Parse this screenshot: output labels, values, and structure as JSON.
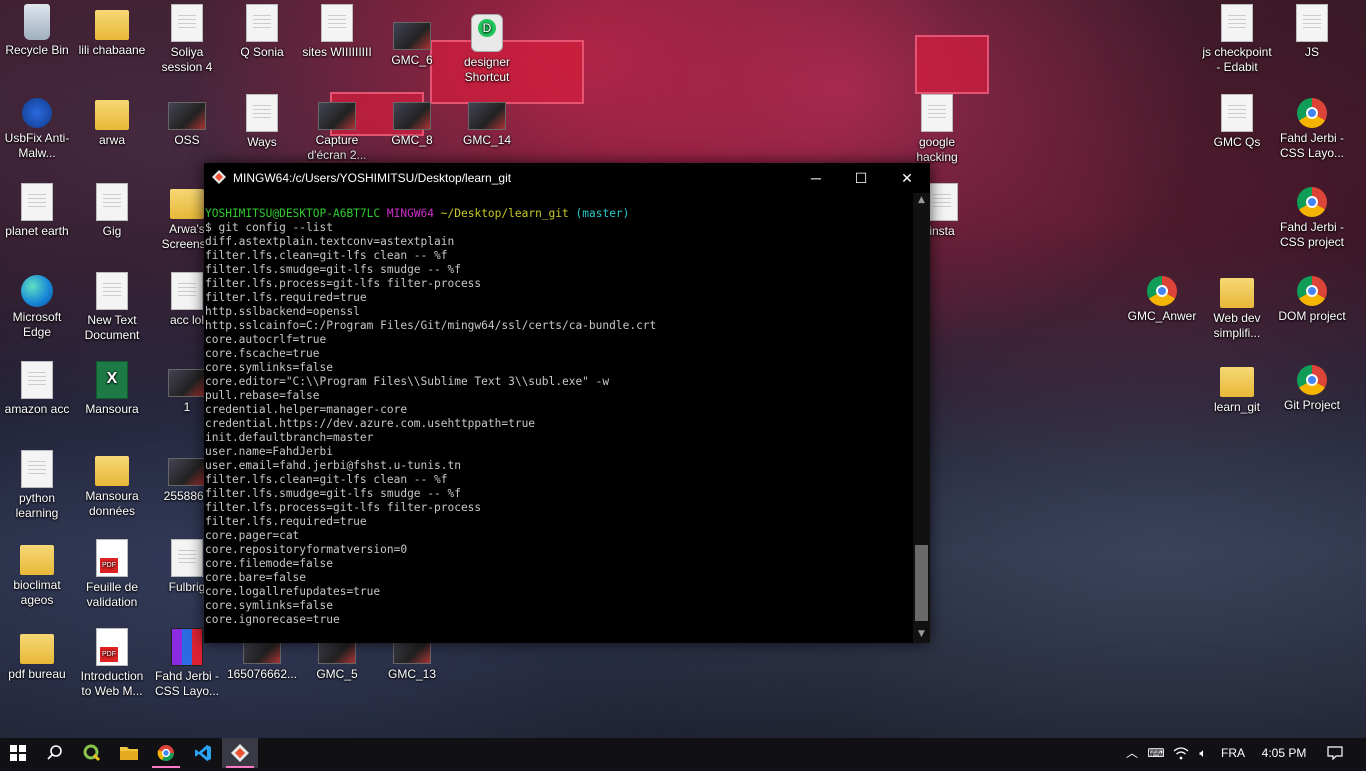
{
  "desktop": {
    "icons": [
      {
        "label": "Recycle Bin",
        "type": "recycle"
      },
      {
        "label": "lili chabaane",
        "type": "folder"
      },
      {
        "label": "Soliya session 4",
        "type": "doc"
      },
      {
        "label": "Q Sonia",
        "type": "doc"
      },
      {
        "label": "sites WIIIIIIIII",
        "type": "doc"
      },
      {
        "label": "GMC_6",
        "type": "img"
      },
      {
        "label": "designer Shortcut",
        "type": "gitbash"
      },
      {
        "label": "js checkpoint - Edabit",
        "type": "doc"
      },
      {
        "label": "JS",
        "type": "doc"
      },
      {
        "label": "UsbFix Anti-Malw...",
        "type": "usb"
      },
      {
        "label": "arwa",
        "type": "folder"
      },
      {
        "label": "OSS",
        "type": "img"
      },
      {
        "label": "Ways",
        "type": "doc"
      },
      {
        "label": "Capture d'écran 2...",
        "type": "img"
      },
      {
        "label": "GMC_8",
        "type": "img"
      },
      {
        "label": "GMC_14",
        "type": "img"
      },
      {
        "label": "google hacking",
        "type": "doc"
      },
      {
        "label": "GMC Qs",
        "type": "doc"
      },
      {
        "label": "Fahd Jerbi - CSS Layo...",
        "type": "chrome"
      },
      {
        "label": "planet earth",
        "type": "doc"
      },
      {
        "label": "Gig",
        "type": "doc"
      },
      {
        "label": "Arwa's Screensh",
        "type": "folder"
      },
      {
        "label": "insta",
        "type": "doc"
      },
      {
        "label": "Fahd Jerbi - CSS project",
        "type": "chrome"
      },
      {
        "label": "Microsoft Edge",
        "type": "edge"
      },
      {
        "label": "New Text Document",
        "type": "doc"
      },
      {
        "label": "acc lol",
        "type": "doc"
      },
      {
        "label": "GMC_Anwer",
        "type": "chrome"
      },
      {
        "label": "Web dev simplifi...",
        "type": "folder"
      },
      {
        "label": "DOM project",
        "type": "chrome"
      },
      {
        "label": "amazon acc",
        "type": "doc"
      },
      {
        "label": "Mansoura",
        "type": "excel"
      },
      {
        "label": "1",
        "type": "img"
      },
      {
        "label": "learn_git",
        "type": "folder"
      },
      {
        "label": "Git Project",
        "type": "chrome"
      },
      {
        "label": "python learning",
        "type": "doc"
      },
      {
        "label": "Mansoura données",
        "type": "folder"
      },
      {
        "label": "2558868",
        "type": "img"
      },
      {
        "label": "bioclimat ageos",
        "type": "folder"
      },
      {
        "label": "Feuille de validation",
        "type": "pdf"
      },
      {
        "label": "Fulbrig",
        "type": "doc"
      },
      {
        "label": "pdf bureau",
        "type": "folder"
      },
      {
        "label": "Introduction to Web M...",
        "type": "pdf"
      },
      {
        "label": "Fahd Jerbi - CSS Layo...",
        "type": "rar"
      },
      {
        "label": "165076662...",
        "type": "img"
      },
      {
        "label": "GMC_5",
        "type": "img"
      },
      {
        "label": "GMC_13",
        "type": "img"
      }
    ]
  },
  "terminal": {
    "title": "MINGW64:/c/Users/YOSHIMITSU/Desktop/learn_git",
    "controls": {
      "minimize": "─",
      "maximize": "☐",
      "close": "✕"
    },
    "prompt": {
      "user": "YOSHIMITSU@DESKTOP-A6BT7LC",
      "system": "MINGW64",
      "path": "~/Desktop/learn_git",
      "branch": "(master)"
    },
    "command": "$ git config --list",
    "output": [
      "diff.astextplain.textconv=astextplain",
      "filter.lfs.clean=git-lfs clean -- %f",
      "filter.lfs.smudge=git-lfs smudge -- %f",
      "filter.lfs.process=git-lfs filter-process",
      "filter.lfs.required=true",
      "http.sslbackend=openssl",
      "http.sslcainfo=C:/Program Files/Git/mingw64/ssl/certs/ca-bundle.crt",
      "core.autocrlf=true",
      "core.fscache=true",
      "core.symlinks=false",
      "core.editor=\"C:\\\\Program Files\\\\Sublime Text 3\\\\subl.exe\" -w",
      "pull.rebase=false",
      "credential.helper=manager-core",
      "credential.https://dev.azure.com.usehttppath=true",
      "init.defaultbranch=master",
      "user.name=FahdJerbi",
      "user.email=fahd.jerbi@fshst.u-tunis.tn",
      "filter.lfs.clean=git-lfs clean -- %f",
      "filter.lfs.smudge=git-lfs smudge -- %f",
      "filter.lfs.process=git-lfs filter-process",
      "filter.lfs.required=true",
      "core.pager=cat",
      "core.repositoryformatversion=0",
      "core.filemode=false",
      "core.bare=false",
      "core.logallrefupdates=true",
      "core.symlinks=false",
      "core.ignorecase=true"
    ]
  },
  "taskbar": {
    "apps": [
      "start-button",
      "search",
      "qgis",
      "file-explorer",
      "chrome",
      "vscode",
      "git-bash"
    ],
    "tray": {
      "language": "FRA",
      "time": "4:05 PM"
    }
  }
}
